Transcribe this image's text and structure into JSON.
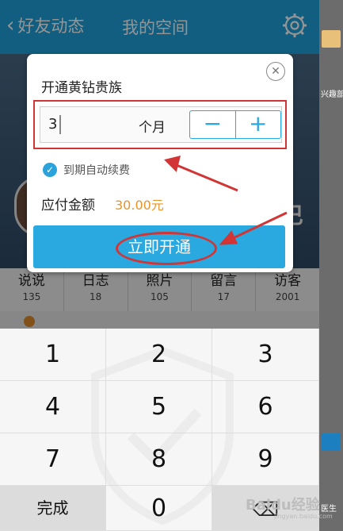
{
  "header": {
    "back_label": "好友动态",
    "title": "我的空间"
  },
  "background": {
    "cover_text": "巴"
  },
  "stats": [
    {
      "label": "说说",
      "count": "135"
    },
    {
      "label": "日志",
      "count": "18"
    },
    {
      "label": "照片",
      "count": "105"
    },
    {
      "label": "留言",
      "count": "17"
    },
    {
      "label": "访客",
      "count": "2001"
    }
  ],
  "dialog": {
    "title": "开通黄钻贵族",
    "quantity_value": "3",
    "unit": "个月",
    "minus": "−",
    "plus": "+",
    "auto_renew_label": "到期自动续费",
    "amount_label": "应付金额",
    "amount_value": "30.00元",
    "submit_label": "立即开通"
  },
  "keypad": {
    "keys": [
      "1",
      "2",
      "3",
      "4",
      "5",
      "6",
      "7",
      "8",
      "9"
    ],
    "done_label": "完成",
    "zero": "0"
  },
  "side": {
    "texts": [
      "兴趣部",
      "医生"
    ]
  },
  "watermark": {
    "text": "Baidu经验",
    "sub": "jingyan.baidu.com"
  },
  "colors": {
    "accent": "#2aa9e0",
    "annotation_red": "#d23535",
    "amount": "#e8942a"
  }
}
